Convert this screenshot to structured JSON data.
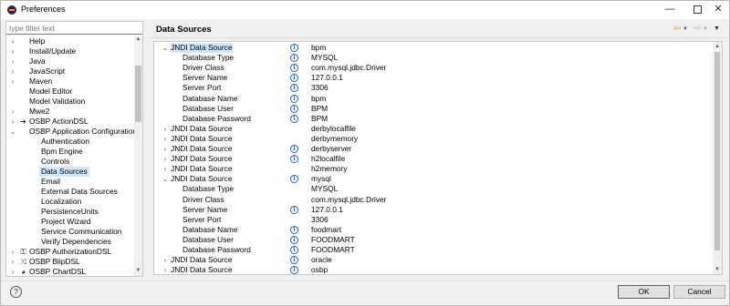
{
  "window": {
    "title": "Preferences"
  },
  "filter": {
    "placeholder": "type filter text"
  },
  "tree": [
    {
      "label": "Help",
      "arrow": "›",
      "level": 1
    },
    {
      "label": "Install/Update",
      "arrow": "›",
      "level": 1
    },
    {
      "label": "Java",
      "arrow": "›",
      "level": 1
    },
    {
      "label": "JavaScript",
      "arrow": "›",
      "level": 1
    },
    {
      "label": "Maven",
      "arrow": "›",
      "level": 1
    },
    {
      "label": "Model Editor",
      "arrow": "",
      "level": 1
    },
    {
      "label": "Model Validation",
      "arrow": "",
      "level": 1
    },
    {
      "label": "Mwe2",
      "arrow": "›",
      "level": 1
    },
    {
      "label": "OSBP ActionDSL",
      "arrow": "›",
      "level": 1,
      "icon": "action-icon"
    },
    {
      "label": "OSBP Application Configuration",
      "arrow": "⌄",
      "level": 1
    },
    {
      "label": "Authentication",
      "arrow": "",
      "level": 2
    },
    {
      "label": "Bpm Engine",
      "arrow": "",
      "level": 2
    },
    {
      "label": "Controls",
      "arrow": "",
      "level": 2
    },
    {
      "label": "Data Sources",
      "arrow": "",
      "level": 2,
      "selected": true
    },
    {
      "label": "Email",
      "arrow": "",
      "level": 2
    },
    {
      "label": "External Data Sources",
      "arrow": "",
      "level": 2
    },
    {
      "label": "Localization",
      "arrow": "",
      "level": 2
    },
    {
      "label": "PersistenceUnits",
      "arrow": "",
      "level": 2
    },
    {
      "label": "Project Wizard",
      "arrow": "",
      "level": 2
    },
    {
      "label": "Service Communication",
      "arrow": "",
      "level": 2
    },
    {
      "label": "Verify Dependencies",
      "arrow": "",
      "level": 2
    },
    {
      "label": "OSBP AuthorizationDSL",
      "arrow": "›",
      "level": 1,
      "icon": "key-icon"
    },
    {
      "label": "OSBP BlipDSL",
      "arrow": "›",
      "level": 1,
      "icon": "shuffle-icon"
    },
    {
      "label": "OSBP ChartDSL",
      "arrow": "›",
      "level": 1,
      "icon": "chart-icon"
    }
  ],
  "page": {
    "title": "Data Sources"
  },
  "rows": [
    {
      "arrow": "⌄",
      "key": "JNDI Data Source",
      "info": true,
      "value": "bpm",
      "indent": 0,
      "selected": true
    },
    {
      "arrow": "",
      "key": "Database Type",
      "info": true,
      "value": "MYSQL",
      "indent": 1
    },
    {
      "arrow": "",
      "key": "Driver Class",
      "info": true,
      "value": "com.mysql.jdbc.Driver",
      "indent": 1
    },
    {
      "arrow": "",
      "key": "Server Name",
      "info": true,
      "value": "127.0.0.1",
      "indent": 1
    },
    {
      "arrow": "",
      "key": "Server Port",
      "info": true,
      "value": "3306",
      "indent": 1
    },
    {
      "arrow": "",
      "key": "Database Name",
      "info": true,
      "value": "bpm",
      "indent": 1
    },
    {
      "arrow": "",
      "key": "Database User",
      "info": true,
      "value": "BPM",
      "indent": 1
    },
    {
      "arrow": "",
      "key": "Database Password",
      "info": true,
      "value": "BPM",
      "indent": 1
    },
    {
      "arrow": "›",
      "key": "JNDI Data Source",
      "info": false,
      "value": "derbylocalfile",
      "indent": 0
    },
    {
      "arrow": "›",
      "key": "JNDI Data Source",
      "info": false,
      "value": "derbymemory",
      "indent": 0
    },
    {
      "arrow": "›",
      "key": "JNDI Data Source",
      "info": true,
      "value": "derbyserver",
      "indent": 0
    },
    {
      "arrow": "›",
      "key": "JNDI Data Source",
      "info": true,
      "value": "h2localfile",
      "indent": 0
    },
    {
      "arrow": "›",
      "key": "JNDI Data Source",
      "info": false,
      "value": "h2memory",
      "indent": 0
    },
    {
      "arrow": "⌄",
      "key": "JNDI Data Source",
      "info": true,
      "value": "mysql",
      "indent": 0
    },
    {
      "arrow": "",
      "key": "Database Type",
      "info": false,
      "value": "MYSQL",
      "indent": 1
    },
    {
      "arrow": "",
      "key": "Driver Class",
      "info": false,
      "value": "com.mysql.jdbc.Driver",
      "indent": 1
    },
    {
      "arrow": "",
      "key": "Server Name",
      "info": true,
      "value": "127.0.0.1",
      "indent": 1
    },
    {
      "arrow": "",
      "key": "Server Port",
      "info": false,
      "value": "3306",
      "indent": 1
    },
    {
      "arrow": "",
      "key": "Database Name",
      "info": true,
      "value": "foodmart",
      "indent": 1
    },
    {
      "arrow": "",
      "key": "Database User",
      "info": true,
      "value": "FOODMART",
      "indent": 1
    },
    {
      "arrow": "",
      "key": "Database Password",
      "info": true,
      "value": "FOODMART",
      "indent": 1
    },
    {
      "arrow": "›",
      "key": "JNDI Data Source",
      "info": true,
      "value": "oracle",
      "indent": 0
    },
    {
      "arrow": "›",
      "key": "JNDI Data Source",
      "info": true,
      "value": "osbp",
      "indent": 0
    }
  ],
  "buttons": {
    "ok": "OK",
    "cancel": "Cancel",
    "help": "?"
  },
  "colors": {
    "selection": "#cce8ff",
    "info": "#2a62b8",
    "accent": "#0078d7"
  }
}
